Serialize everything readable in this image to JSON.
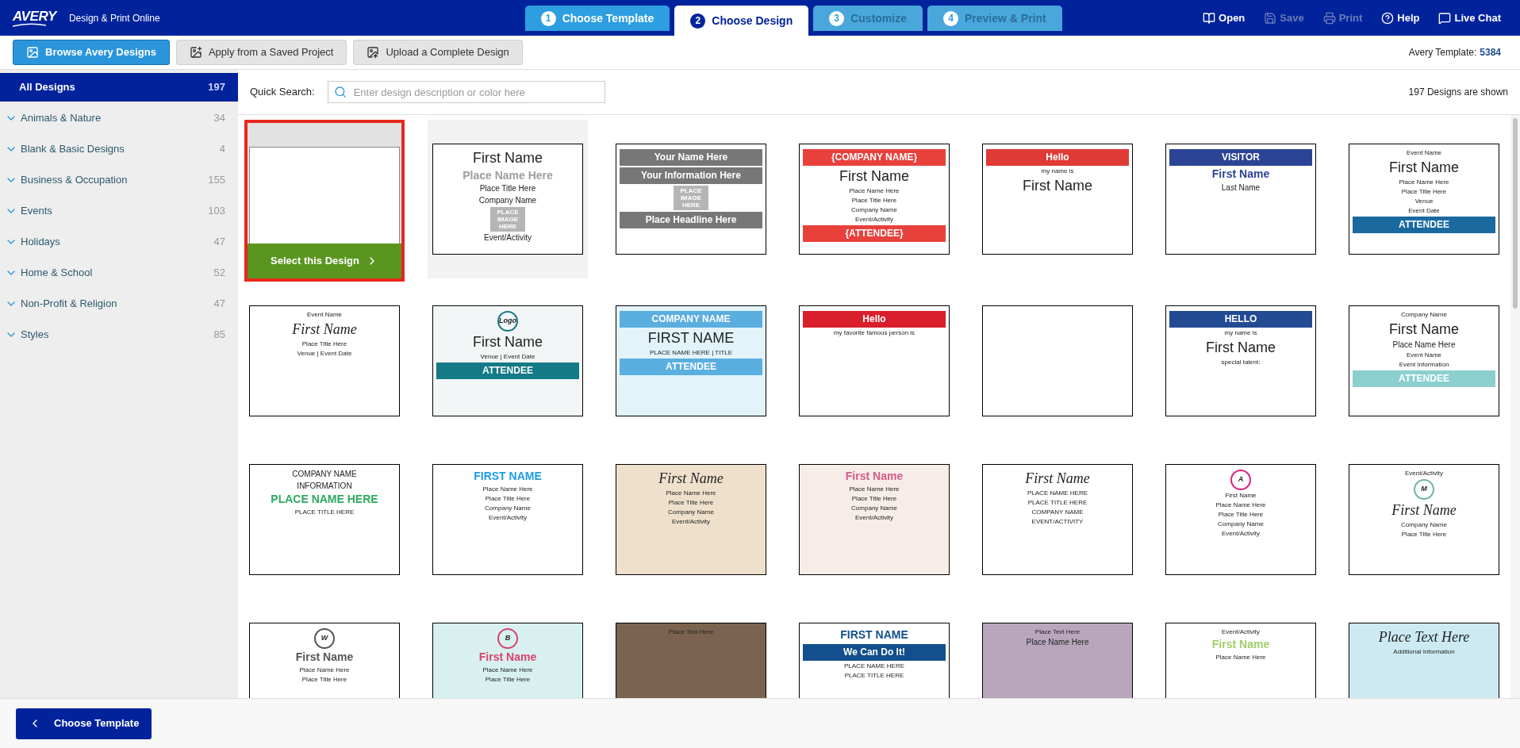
{
  "app": {
    "brand": "AVERY",
    "subtitle": "Design & Print Online"
  },
  "steps": [
    {
      "number": "1",
      "label": "Choose Template",
      "selected": false,
      "disabled": false
    },
    {
      "number": "2",
      "label": "Choose Design",
      "selected": true,
      "disabled": false
    },
    {
      "number": "3",
      "label": "Customize",
      "selected": false,
      "disabled": true
    },
    {
      "number": "4",
      "label": "Preview & Print",
      "selected": false,
      "disabled": true
    }
  ],
  "actions": [
    {
      "kind": "open",
      "label": "Open",
      "disabled": false
    },
    {
      "kind": "save",
      "label": "Save",
      "disabled": true
    },
    {
      "kind": "print",
      "label": "Print",
      "disabled": true
    },
    {
      "kind": "help",
      "label": "Help",
      "disabled": false
    },
    {
      "kind": "chat",
      "label": "Live Chat",
      "disabled": false
    }
  ],
  "toolbar": {
    "buttons": [
      {
        "kind": "browse",
        "label": "Browse Avery Designs",
        "selected": true
      },
      {
        "kind": "apply",
        "label": "Apply from a Saved Project",
        "selected": false
      },
      {
        "kind": "upload",
        "label": "Upload a Complete Design",
        "selected": false
      }
    ],
    "template_label": "Avery Template:",
    "template_number": "5384"
  },
  "sidebar": {
    "items": [
      {
        "kind": "all",
        "label": "All Designs",
        "count": "197",
        "selected": true
      },
      {
        "kind": "category",
        "label": "Animals & Nature",
        "count": "34",
        "selected": false
      },
      {
        "kind": "category",
        "label": "Blank & Basic Designs",
        "count": "4",
        "selected": false
      },
      {
        "kind": "category",
        "label": "Business & Occupation",
        "count": "155",
        "selected": false
      },
      {
        "kind": "category",
        "label": "Events",
        "count": "103",
        "selected": false
      },
      {
        "kind": "category",
        "label": "Holidays",
        "count": "47",
        "selected": false
      },
      {
        "kind": "category",
        "label": "Home & School",
        "count": "52",
        "selected": false
      },
      {
        "kind": "category",
        "label": "Non-Profit & Religion",
        "count": "47",
        "selected": false
      },
      {
        "kind": "category",
        "label": "Styles",
        "count": "85",
        "selected": false
      }
    ]
  },
  "search": {
    "label": "Quick Search:",
    "placeholder": "Enter design description or color here"
  },
  "result_count": "197 Designs are shown",
  "select_button": "Select this Design",
  "designs": [
    {
      "selected": true,
      "hovered": false
    },
    {
      "selected": false,
      "hovered": true,
      "lines": [
        {
          "kind": "big",
          "text": "First Name"
        },
        {
          "kind": "mid",
          "text": "Place Name Here"
        },
        {
          "kind": "text",
          "text": "Place Title Here"
        },
        {
          "kind": "text",
          "text": "Company Name"
        },
        {
          "kind": "imagebox",
          "text": "PLACE IMAGE HERE"
        },
        {
          "kind": "text",
          "text": "Event/Activity"
        }
      ]
    },
    {
      "selected": false,
      "hovered": false,
      "lines": [
        {
          "kind": "band",
          "text": "Your Name Here"
        },
        {
          "kind": "band",
          "text": "Your Information Here"
        },
        {
          "kind": "imagebox",
          "text": "PLACE IMAGE HERE"
        },
        {
          "kind": "band",
          "text": "Place Headline Here"
        }
      ]
    },
    {
      "selected": false,
      "hovered": false,
      "lines": [
        {
          "kind": "band",
          "text": "{COMPANY NAME}"
        },
        {
          "kind": "big",
          "text": "First Name"
        },
        {
          "kind": "small",
          "text": "Place Name Here"
        },
        {
          "kind": "small",
          "text": "Place Title Here"
        },
        {
          "kind": "small",
          "text": "Company Name"
        },
        {
          "kind": "small",
          "text": "Event/Activity"
        },
        {
          "kind": "band",
          "text": "{ATTENDEE}"
        }
      ]
    },
    {
      "selected": false,
      "hovered": false,
      "lines": [
        {
          "kind": "band",
          "text": "Hello"
        },
        {
          "kind": "small",
          "text": "my name is"
        },
        {
          "kind": "big",
          "text": "First Name"
        }
      ]
    },
    {
      "selected": false,
      "hovered": false,
      "lines": [
        {
          "kind": "band",
          "text": "VISITOR"
        },
        {
          "kind": "mid",
          "text": "First Name"
        },
        {
          "kind": "text",
          "text": "Last Name"
        }
      ]
    },
    {
      "selected": false,
      "hovered": false,
      "lines": [
        {
          "kind": "small",
          "text": "Event Name"
        },
        {
          "kind": "big",
          "text": "First Name"
        },
        {
          "kind": "small",
          "text": "Place Name Here"
        },
        {
          "kind": "small",
          "text": "Place Title Here"
        },
        {
          "kind": "small",
          "text": "Venue"
        },
        {
          "kind": "small",
          "text": "Event Date"
        },
        {
          "kind": "band",
          "text": "ATTENDEE"
        }
      ]
    },
    {
      "selected": false,
      "hovered": false,
      "lines": [
        {
          "kind": "small",
          "text": "Event Name"
        },
        {
          "kind": "script",
          "text": "First Name"
        },
        {
          "kind": "small",
          "text": "Place Title Here"
        },
        {
          "kind": "small",
          "text": "Venue | Event Date"
        }
      ]
    },
    {
      "selected": false,
      "hovered": false,
      "lines": [
        {
          "kind": "logo",
          "text": "Logo"
        },
        {
          "kind": "big",
          "text": "First Name"
        },
        {
          "kind": "small",
          "text": "Venue | Event Date"
        },
        {
          "kind": "band",
          "text": "ATTENDEE"
        }
      ]
    },
    {
      "selected": false,
      "hovered": false,
      "lines": [
        {
          "kind": "band",
          "text": "COMPANY NAME"
        },
        {
          "kind": "big",
          "text": "FIRST NAME"
        },
        {
          "kind": "small",
          "text": "PLACE NAME HERE | TITLE"
        },
        {
          "kind": "band",
          "text": "ATTENDEE"
        }
      ]
    },
    {
      "selected": false,
      "hovered": false,
      "lines": [
        {
          "kind": "band",
          "text": "Hello"
        },
        {
          "kind": "small",
          "text": "my favorite famous person is"
        }
      ]
    },
    {
      "selected": false,
      "hovered": false
    },
    {
      "selected": false,
      "hovered": false,
      "lines": [
        {
          "kind": "band",
          "text": "HELLO"
        },
        {
          "kind": "small",
          "text": "my name is"
        },
        {
          "kind": "big",
          "text": "First Name"
        },
        {
          "kind": "small",
          "text": "special talent:"
        }
      ]
    },
    {
      "selected": false,
      "hovered": false,
      "lines": [
        {
          "kind": "small",
          "text": "Company Name"
        },
        {
          "kind": "big",
          "text": "First Name"
        },
        {
          "kind": "text",
          "text": "Place Name Here"
        },
        {
          "kind": "small",
          "text": "Event Name"
        },
        {
          "kind": "small",
          "text": "Event Information"
        },
        {
          "kind": "band",
          "text": "ATTENDEE"
        }
      ]
    },
    {
      "selected": false,
      "hovered": false,
      "lines": [
        {
          "kind": "text",
          "text": "COMPANY NAME"
        },
        {
          "kind": "text",
          "text": "INFORMATION"
        },
        {
          "kind": "mid",
          "text": "PLACE NAME HERE"
        },
        {
          "kind": "small",
          "text": "PLACE TITLE HERE"
        }
      ]
    },
    {
      "selected": false,
      "hovered": false,
      "lines": [
        {
          "kind": "mid",
          "text": "FIRST NAME"
        },
        {
          "kind": "small",
          "text": "Place Name Here"
        },
        {
          "kind": "small",
          "text": "Place Title Here"
        },
        {
          "kind": "small",
          "text": "Company Name"
        },
        {
          "kind": "small",
          "text": "Event/Activity"
        }
      ]
    },
    {
      "selected": false,
      "hovered": false,
      "lines": [
        {
          "kind": "script",
          "text": "First Name"
        },
        {
          "kind": "small",
          "text": "Place Name Here"
        },
        {
          "kind": "small",
          "text": "Place Title Here"
        },
        {
          "kind": "small",
          "text": "Company Name"
        },
        {
          "kind": "small",
          "text": "Event/Activity"
        }
      ]
    },
    {
      "selected": false,
      "hovered": false,
      "lines": [
        {
          "kind": "mid",
          "text": "First Name"
        },
        {
          "kind": "small",
          "text": "Place Name Here"
        },
        {
          "kind": "small",
          "text": "Place Title Here"
        },
        {
          "kind": "small",
          "text": "Company Name"
        },
        {
          "kind": "small",
          "text": "Event/Activity"
        }
      ]
    },
    {
      "selected": false,
      "hovered": false,
      "lines": [
        {
          "kind": "script",
          "text": "First Name"
        },
        {
          "kind": "small",
          "text": "PLACE NAME HERE"
        },
        {
          "kind": "small",
          "text": "PLACE TITLE HERE"
        },
        {
          "kind": "small",
          "text": "COMPANY NAME"
        },
        {
          "kind": "small",
          "text": "EVENT/ACTIVITY"
        }
      ]
    },
    {
      "selected": false,
      "hovered": false,
      "lines": [
        {
          "kind": "logo",
          "text": "A"
        },
        {
          "kind": "small",
          "text": "First Name"
        },
        {
          "kind": "small",
          "text": "Place Name Here"
        },
        {
          "kind": "small",
          "text": "Place Title Here"
        },
        {
          "kind": "small",
          "text": "Company Name"
        },
        {
          "kind": "small",
          "text": "Event/Activity"
        }
      ]
    },
    {
      "selected": false,
      "hovered": false,
      "lines": [
        {
          "kind": "small",
          "text": "Event/Activity"
        },
        {
          "kind": "logo",
          "text": "M"
        },
        {
          "kind": "script",
          "text": "First Name"
        },
        {
          "kind": "small",
          "text": "Company Name"
        },
        {
          "kind": "small",
          "text": "Place Title Here"
        }
      ]
    },
    {
      "selected": false,
      "hovered": false,
      "lines": [
        {
          "kind": "logo",
          "text": "W"
        },
        {
          "kind": "mid",
          "text": "First Name"
        },
        {
          "kind": "small",
          "text": "Place Name Here"
        },
        {
          "kind": "small",
          "text": "Place Title Here"
        }
      ]
    },
    {
      "selected": false,
      "hovered": false,
      "lines": [
        {
          "kind": "logo",
          "text": "B"
        },
        {
          "kind": "mid",
          "text": "First Name"
        },
        {
          "kind": "small",
          "text": "Place Name Here"
        },
        {
          "kind": "small",
          "text": "Place Title Here"
        }
      ]
    },
    {
      "selected": false,
      "hovered": false,
      "lines": [
        {
          "kind": "small",
          "text": "Place Text Here"
        }
      ]
    },
    {
      "selected": false,
      "hovered": false,
      "lines": [
        {
          "kind": "mid",
          "text": "FIRST NAME"
        },
        {
          "kind": "band",
          "text": "We Can Do It!"
        },
        {
          "kind": "small",
          "text": "PLACE NAME HERE"
        },
        {
          "kind": "small",
          "text": "PLACE TITLE HERE"
        }
      ]
    },
    {
      "selected": false,
      "hovered": false,
      "lines": [
        {
          "kind": "small",
          "text": "Place Text Here"
        },
        {
          "kind": "text",
          "text": "Place Name Here"
        }
      ]
    },
    {
      "selected": false,
      "hovered": false,
      "lines": [
        {
          "kind": "small",
          "text": "Event/Activity"
        },
        {
          "kind": "mid",
          "text": "First Name"
        },
        {
          "kind": "small",
          "text": "Place Name Here"
        }
      ]
    },
    {
      "selected": false,
      "hovered": false,
      "lines": [
        {
          "kind": "script",
          "text": "Place Text Here"
        },
        {
          "kind": "small",
          "text": "Additional Information"
        }
      ]
    }
  ],
  "footer": {
    "back_button": "Choose Template"
  }
}
